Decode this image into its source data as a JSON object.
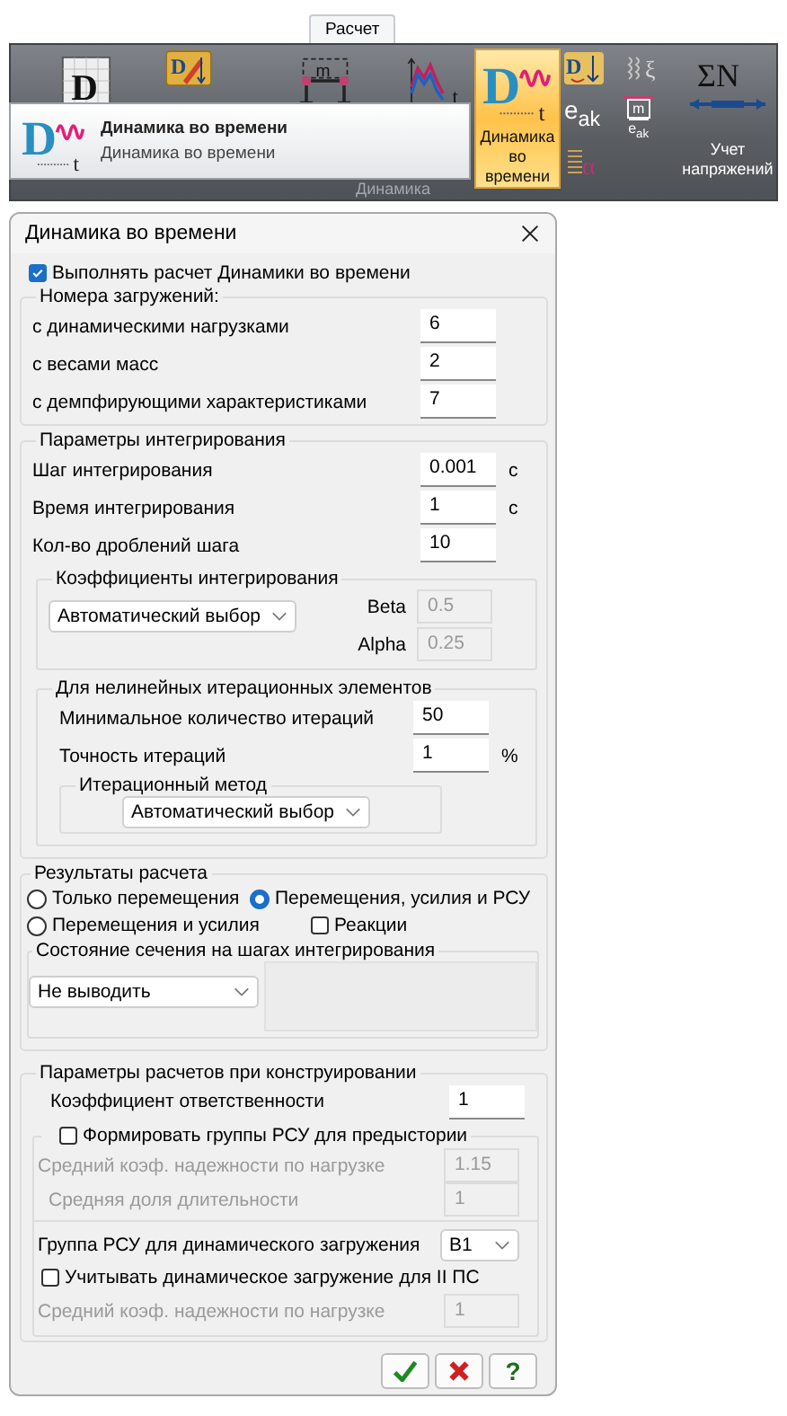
{
  "ribbon": {
    "tab": "Расчет",
    "group": "Динамика",
    "tools": [
      {
        "kind": "grid",
        "glyph": "D"
      },
      {
        "kind": "pencil",
        "glyph": "D"
      },
      {
        "kind": "mass",
        "glyph": "m"
      },
      {
        "kind": "graph",
        "glyph": "t"
      },
      {
        "kind": "large",
        "glyph": "D",
        "sub": "t",
        "label": "Динамика во времени",
        "selected": true
      },
      {
        "kind": "column",
        "items": [
          {
            "kind": "arrow",
            "glyph": "D"
          },
          {
            "kind": "text",
            "text": "e$_{ak}$"
          },
          {
            "kind": "spring",
            "glyph": "α"
          }
        ]
      },
      {
        "kind": "column",
        "items": [
          {
            "kind": "wave",
            "glyph": "ξ"
          },
          {
            "kind": "mass",
            "glyph": "m",
            "sub": "e$_{ak}$"
          }
        ]
      },
      {
        "kind": "sum",
        "glyph": "ΣN",
        "label": "Учет напряжений",
        "selected": false
      }
    ],
    "tooltip": {
      "glyph": "D",
      "sub": "t",
      "title": "Динамика во времени",
      "text": "Динамика во времени"
    }
  },
  "dialog": {
    "title": "Динамика во времени",
    "run": {
      "label": "Выполнять расчет Динамики во времени",
      "checked": true
    },
    "loads": {
      "title": "Номера загружений:",
      "rows": [
        {
          "label": "с динамическими нагрузками",
          "value": "6"
        },
        {
          "label": "с весами масс",
          "value": "2"
        },
        {
          "label": "с демпфирующими характеристиками",
          "value": "7"
        }
      ]
    },
    "integration": {
      "title": "Параметры интегрирования",
      "rows": [
        {
          "label": "Шаг интегрирования",
          "value": "0.001",
          "unit": "с"
        },
        {
          "label": "Время интегрирования",
          "value": "1",
          "unit": "с"
        },
        {
          "label": "Кол-во дроблений шага",
          "value": "10"
        }
      ],
      "coefficients": {
        "title": "Коэффициенты интегрирования",
        "select": "Автоматический выбор",
        "params": [
          {
            "label": "Beta",
            "value": "0.5",
            "disabled": true
          },
          {
            "label": "Alpha",
            "value": "0.25",
            "disabled": true
          }
        ]
      },
      "nonlinear": {
        "title": "Для нелинейных итерационных элементов",
        "rows": [
          {
            "label": "Минимальное количество итераций",
            "value": "50"
          },
          {
            "label": "Точность итераций",
            "value": "1",
            "unit": "%"
          }
        ],
        "method": {
          "title": "Итерационный метод",
          "select": "Автоматический выбор"
        }
      }
    },
    "results": {
      "title": "Результаты расчета",
      "options": [
        {
          "kind": "radio",
          "label": "Только перемещения",
          "selected": false
        },
        {
          "kind": "radio",
          "label": "Перемещения, усилия и РСУ",
          "selected": true
        },
        {
          "kind": "radio",
          "label": "Перемещения и усилия",
          "selected": false
        },
        {
          "kind": "checkbox",
          "label": "Реакции",
          "checked": false
        }
      ],
      "section_state": {
        "title": "Состояние сечения на шагах интегрирования",
        "select": "Не выводить"
      }
    },
    "design": {
      "title": "Параметры расчетов при конструировании",
      "responsibility": {
        "label": "Коэффициент ответственности",
        "value": "1"
      },
      "history": {
        "label": "Формировать группы РСУ для предыстории",
        "checked": false,
        "rows": [
          {
            "label": "Средний коэф. надежности по нагрузке",
            "value": "1.15",
            "disabled": true
          },
          {
            "label": "Средняя доля длительности",
            "value": "1",
            "disabled": true
          }
        ]
      },
      "group": {
        "label": "Группа РСУ для динамического загружения",
        "select": "B1"
      },
      "second_state": {
        "label": "Учитывать динамическое загружение для II ПС",
        "checked": false,
        "rows": [
          {
            "label": "Средний коэф. надежности по нагрузке",
            "value": "1",
            "disabled": true
          }
        ]
      }
    },
    "buttons": [
      {
        "kind": "ok"
      },
      {
        "kind": "cancel"
      },
      {
        "kind": "help",
        "glyph": "?"
      }
    ]
  }
}
